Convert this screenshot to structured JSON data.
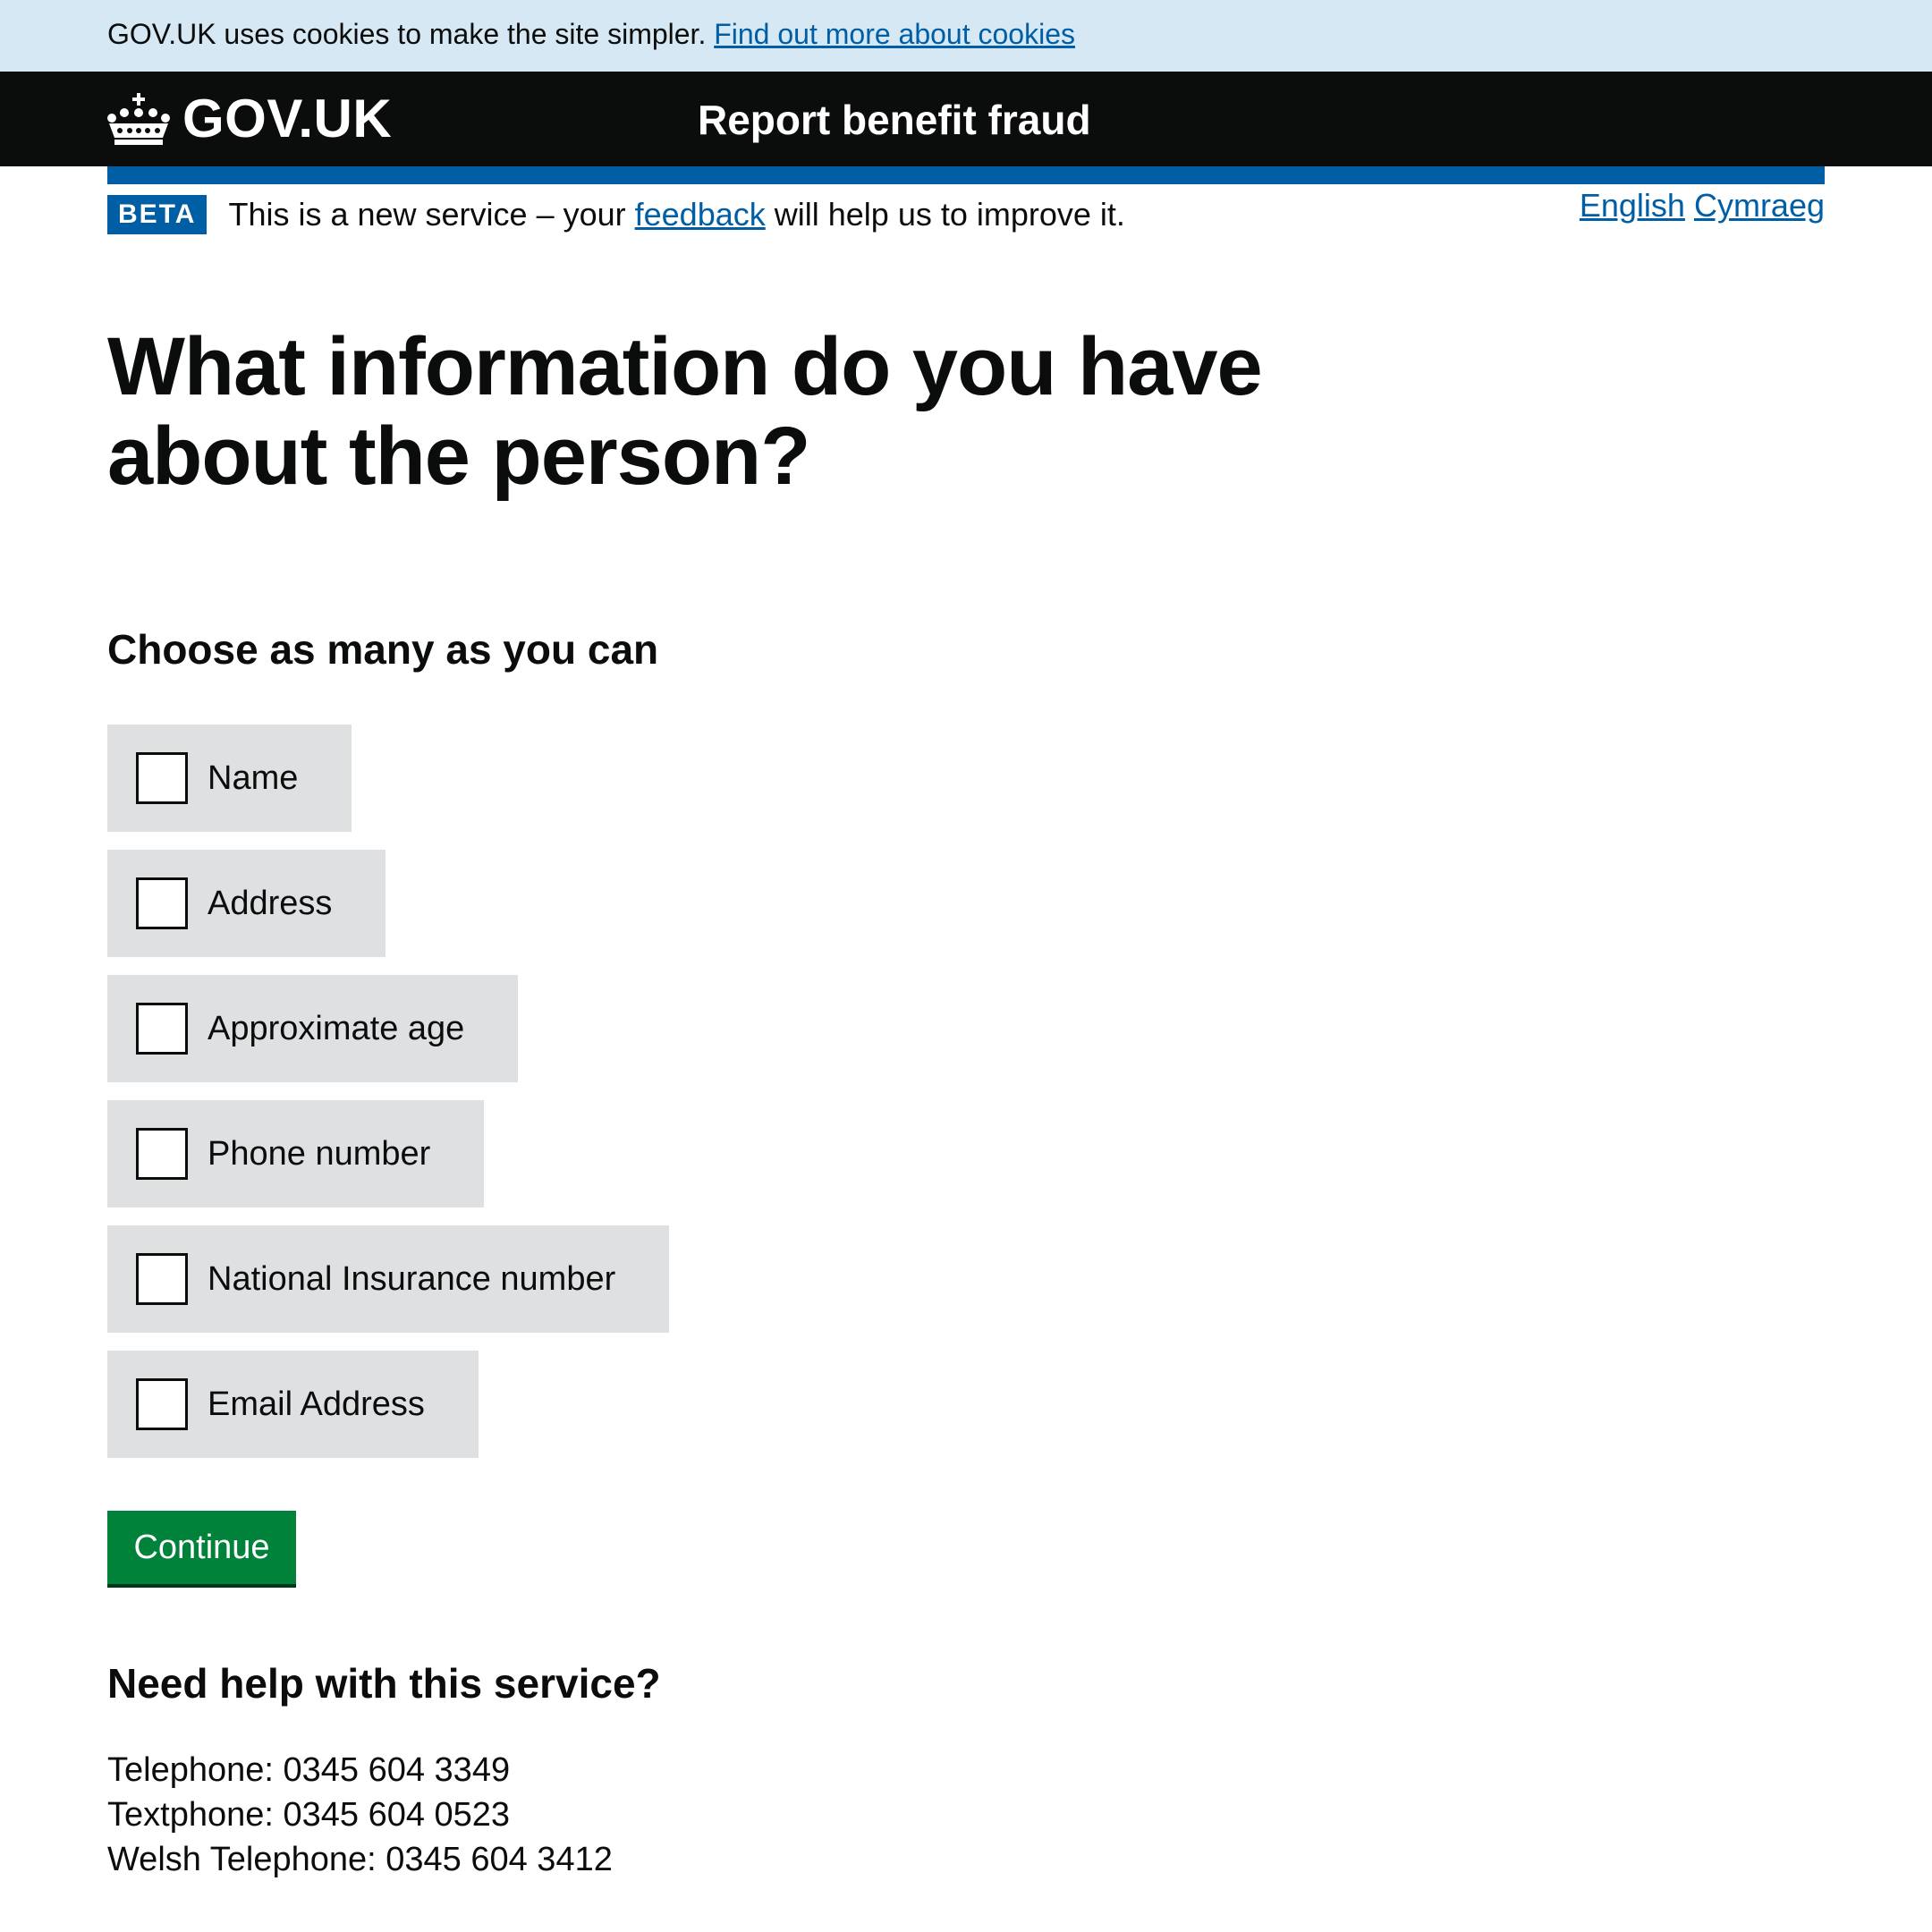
{
  "cookie_banner": {
    "text": "GOV.UK uses cookies to make the site simpler.",
    "link": "Find out more about cookies"
  },
  "header": {
    "logo_text": "GOV.UK",
    "logo_icon": "crown-icon",
    "service_name": "Report benefit fraud"
  },
  "phase_banner": {
    "tag": "BETA",
    "text_before": "This is a new service – your",
    "link": "feedback",
    "text_after": "will help us to improve it."
  },
  "language": {
    "english": "English",
    "welsh": "Cymraeg"
  },
  "page": {
    "title": "What information do you have about the person?",
    "legend": "Choose as many as you can"
  },
  "options": [
    {
      "label": "Name",
      "checked": false
    },
    {
      "label": "Address",
      "checked": false
    },
    {
      "label": "Approximate age",
      "checked": false
    },
    {
      "label": "Phone number",
      "checked": false
    },
    {
      "label": "National Insurance number",
      "checked": false
    },
    {
      "label": "Email Address",
      "checked": false
    }
  ],
  "continue_label": "Continue",
  "help": {
    "heading": "Need help with this service?",
    "telephone": "Telephone: 0345 604 3349",
    "textphone": "Textphone: 0345 604 0523",
    "welsh_telephone": "Welsh Telephone: 0345 604 3412"
  },
  "colors": {
    "cookie_bg": "#d5e8f3",
    "header_bg": "#0b0c0c",
    "brand_blue": "#005ea5",
    "checkbox_bg": "#dee0e2",
    "button_green": "#00823b"
  }
}
